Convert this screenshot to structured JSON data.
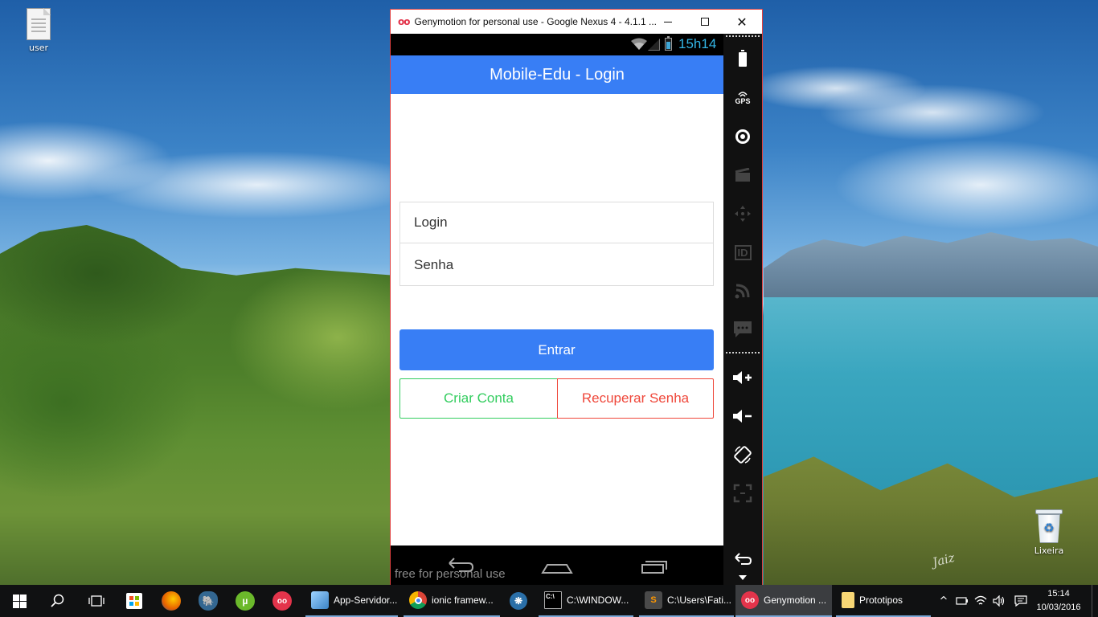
{
  "desktop": {
    "icons": [
      {
        "label": "user",
        "icon": "text-file-icon"
      },
      {
        "label": "Lixeira",
        "icon": "recycle-bin-icon"
      }
    ]
  },
  "genymotion": {
    "logo": "oo",
    "title": "Genymotion for personal use - Google Nexus 4 - 4.1.1 ...",
    "statusbar": {
      "time": "15h14"
    },
    "app": {
      "header_title": "Mobile-Edu - Login",
      "login_placeholder": "Login",
      "senha_placeholder": "Senha",
      "entrar_label": "Entrar",
      "criar_conta_label": "Criar Conta",
      "recuperar_senha_label": "Recuperar Senha",
      "colors": {
        "primary": "#387ef5",
        "balanced": "#33cd5f",
        "assertive": "#ef473a"
      }
    },
    "nav_overlay": "free for personal use",
    "sidebar": {
      "gps_label": "GPS",
      "id_label": "ID",
      "icons": [
        "battery-icon",
        "gps-icon",
        "webcam-icon",
        "capture-icon",
        "remote-control-icon",
        "identifiers-icon",
        "network-icon",
        "sms-icon",
        "volume-up-icon",
        "volume-down-icon",
        "rotate-icon",
        "pixel-perfect-icon",
        "back-icon",
        "more-icon"
      ]
    }
  },
  "taskbar": {
    "apps": [
      {
        "label": "App-Servidor...",
        "icon": "cube-icon"
      },
      {
        "label": "ionic framew...",
        "icon": "chrome-icon"
      },
      {
        "label": "C:\\WINDOW...",
        "icon": "cmd-icon"
      },
      {
        "label": "C:\\Users\\Fati...",
        "icon": "sublime-icon"
      },
      {
        "label": "Genymotion ...",
        "icon": "genymotion-icon"
      },
      {
        "label": "Prototipos",
        "icon": "folder-icon"
      }
    ],
    "clock": {
      "time": "15:14",
      "date": "10/03/2016"
    }
  }
}
